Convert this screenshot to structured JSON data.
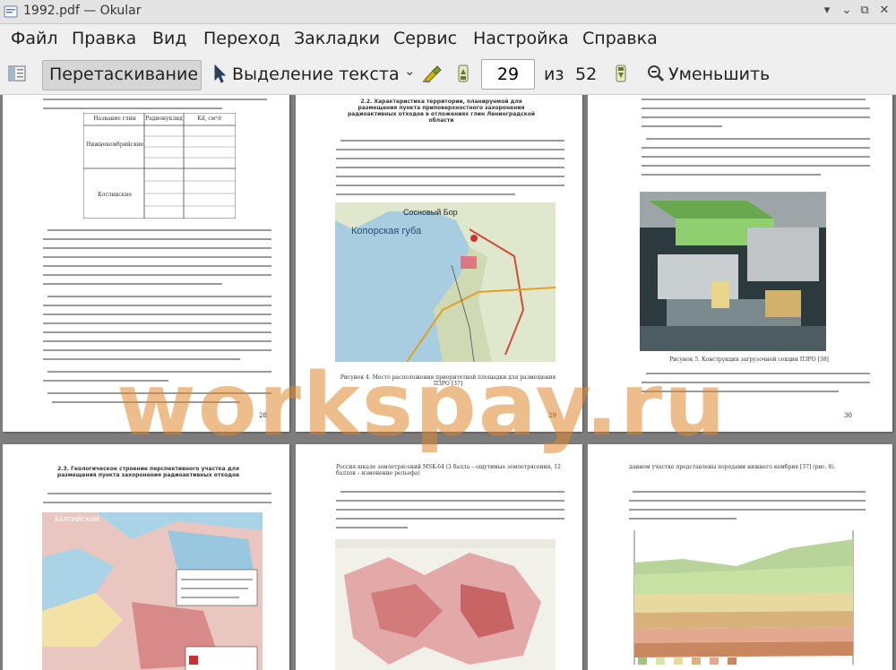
{
  "window": {
    "title": "1992.pdf — Okular"
  },
  "menu": [
    "Файл",
    "Правка",
    "Вид",
    "Переход",
    "Закладки",
    "Сервис",
    "Настройка",
    "Справка"
  ],
  "toolbar": {
    "browse_label": "Перетаскивание",
    "select_label": "Выделение текста",
    "current_page": "29",
    "of_label": "из",
    "total_pages": "52",
    "zoom_out_label": "Уменьшить"
  },
  "watermark": "workspay.ru",
  "pages": {
    "p28": {
      "number": "28",
      "table_h1": "Название глин",
      "table_h2": "Радионуклид",
      "table_h3": "Kd, см³/г",
      "row1": "Нижнекембрийские",
      "row2": "Котлинские"
    },
    "p29": {
      "number": "29",
      "heading": "2.2. Характеристика территории, планируемой для размещения пункта приповерхностного захоронения радиоактивных отходов в отложениях глин Ленинградской области",
      "map_label_1": "Сосновый Бор",
      "map_label_2": "Копорская губа",
      "caption": "Рисунок 4. Место расположения приоритетной площадки для размещения ПЗРО [37]"
    },
    "p30": {
      "number": "30",
      "caption": "Рисунок 5. Конструкция загрузочной секции ПЗРО [38]"
    },
    "p31": {
      "heading": "2.3. Геологическое строение перспективного участка для размещения пункта захоронения радиоактивных отходов"
    },
    "p32": {
      "text": "Россия шкале землетрясений MSK-64 (3 балла – ощутимые землетрясения, 12 баллов – изменение рельефа)"
    },
    "p33": {
      "text": "данном участке представлены породами нижнего кембрия [37] (рис. 8)."
    }
  }
}
